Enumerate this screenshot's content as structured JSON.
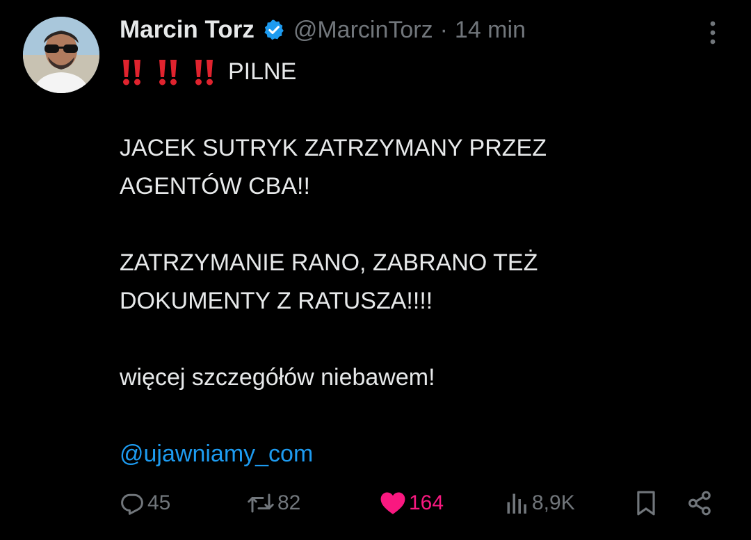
{
  "author": {
    "name": "Marcin Torz",
    "handle": "@MarcinTorz",
    "separator": "·",
    "time": "14 min",
    "verified_icon": "verified-badge-icon",
    "avatar": "avatar-photo"
  },
  "tweet": {
    "lines": [
      "PILNE",
      "JACEK SUTRYK ZATRZYMANY PRZEZ",
      "AGENTÓW CBA!!",
      "ZATRZYMANIE RANO, ZABRANO TEŻ",
      "DOKUMENTY Z RATUSZA!!!!",
      "więcej szczegółów niebawem!",
      "@ujawniamy_com"
    ],
    "emoji": "double-exclamation-icon"
  },
  "actions": {
    "replies": "45",
    "reposts": "82",
    "likes": "164",
    "views": "8,9K"
  },
  "colors": {
    "background": "#000000",
    "text": "#e7e9ea",
    "secondary": "#71767b",
    "link": "#1d9bf0",
    "like": "#f91880",
    "emoji": "#e0232e"
  }
}
